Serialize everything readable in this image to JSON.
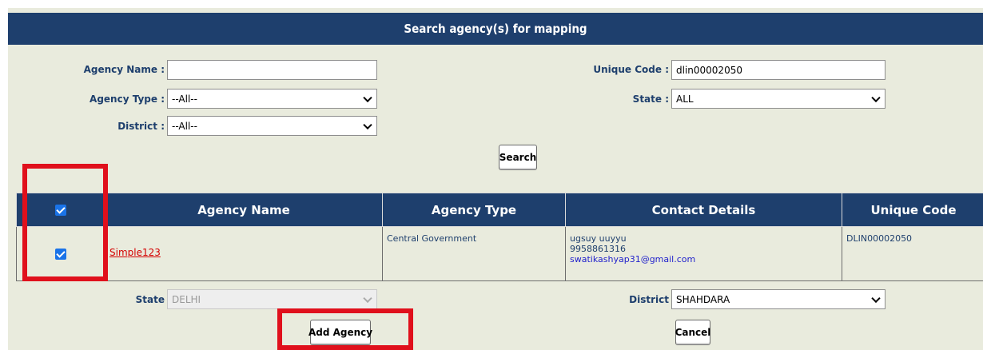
{
  "title": "Search agency(s) for mapping",
  "search": {
    "agency_name_label": "Agency Name :",
    "agency_name_value": "",
    "agency_type_label": "Agency Type :",
    "agency_type_value": "--All--",
    "district_label": "District :",
    "district_value": "--All--",
    "unique_code_label": "Unique Code :",
    "unique_code_value": "dlin00002050",
    "state_label": "State :",
    "state_value": "ALL",
    "search_button": "Search"
  },
  "table": {
    "headers": [
      "Agency Name",
      "Agency Type",
      "Contact Details",
      "Unique Code"
    ],
    "rows": [
      {
        "agency_name": "Simple123",
        "agency_type": "Central Government",
        "contact_name": "ugsuy uuyyu",
        "contact_phone": "9958861316",
        "contact_email": "swatikashyap31@gmail.com",
        "unique_code": "DLIN00002050",
        "checked": true
      }
    ],
    "select_all_checked": true
  },
  "mapping": {
    "state_label": "State",
    "state_value": "DELHI",
    "district_label": "District",
    "district_value": "SHAHDARA",
    "add_button": "Add Agency",
    "cancel_button": "Cancel"
  },
  "colors": {
    "header_blue": "#1e3f6d",
    "panel_bg": "#e9ebdd",
    "highlight_red": "#e0101c",
    "checkbox_blue": "#1a73e8"
  }
}
